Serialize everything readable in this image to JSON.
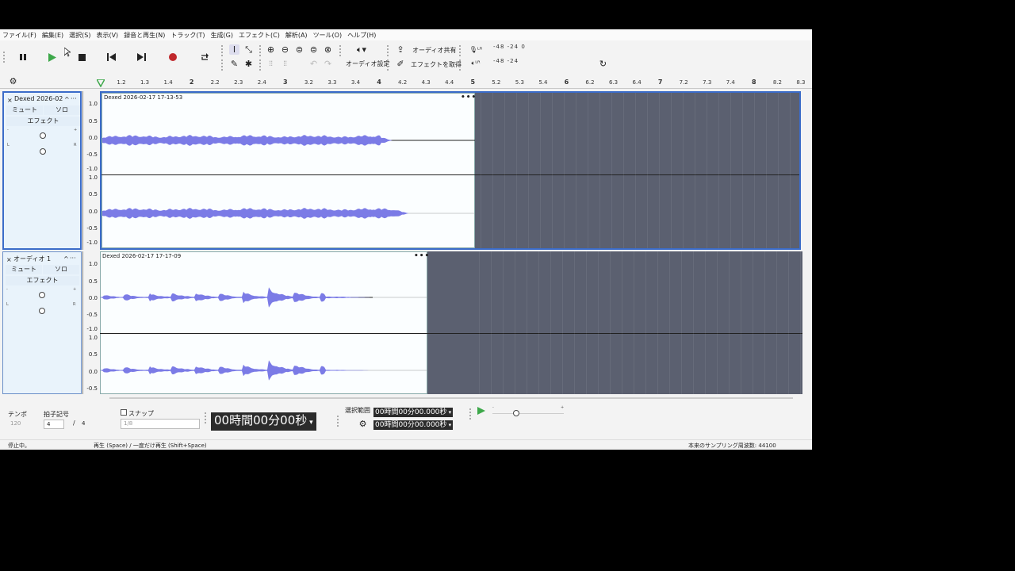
{
  "menu": [
    "ファイル(F)",
    "編集(E)",
    "選択(S)",
    "表示(V)",
    "録音と再生(N)",
    "トラック(T)",
    "生成(G)",
    "エフェクト(C)",
    "解析(A)",
    "ツール(O)",
    "ヘルプ(H)"
  ],
  "toolbar": {
    "audio_setup_label": "オーディオ設定",
    "share_audio_label": "オーディオ共有",
    "get_effects_label": "エフェクトを取得",
    "meter_scale_1": "-48   -24   0",
    "meter_scale_2": "-48   -24"
  },
  "ruler": {
    "ticks": [
      "1.2",
      "1.3",
      "1.4",
      "2",
      "2.2",
      "2.3",
      "2.4",
      "3",
      "3.2",
      "3.3",
      "3.4",
      "4",
      "4.2",
      "4.3",
      "4.4",
      "5",
      "5.2",
      "5.3",
      "5.4",
      "6",
      "6.2",
      "6.3",
      "6.4",
      "7",
      "7.2",
      "7.3",
      "7.4",
      "8",
      "8.2",
      "8.3"
    ],
    "major": [
      "2",
      "3",
      "4",
      "5",
      "6",
      "7",
      "8"
    ]
  },
  "tracks": [
    {
      "name": "Dexed 2026-02",
      "mute_label": "ミュート",
      "solo_label": "ソロ",
      "effects_label": "エフェクト",
      "clip_title": "Dexed 2026-02-17 17-13-53",
      "clip_menu": "•••",
      "gain_minus": "-",
      "gain_plus": "+",
      "pan_left": "L",
      "pan_right": "R",
      "labels_top": [
        "1.0",
        "0.5",
        "0.0",
        "-0.5",
        "-1.0"
      ],
      "labels_bottom": [
        "1.0",
        "0.5",
        "0.0",
        "-0.5",
        "-1.0"
      ]
    },
    {
      "name": "オーディオ 1",
      "mute_label": "ミュート",
      "solo_label": "ソロ",
      "effects_label": "エフェクト",
      "clip_title": "Dexed 2026-02-17 17-17-09",
      "clip_menu": "•••",
      "gain_minus": "-",
      "gain_plus": "+",
      "pan_left": "L",
      "pan_right": "R",
      "labels_top": [
        "1.0",
        "0.5",
        "0.0",
        "-0.5",
        "-1.0"
      ],
      "labels_bottom": [
        "1.0",
        "0.5",
        "0.0",
        "-0.5"
      ]
    }
  ],
  "bottom": {
    "tempo_label": "テンポ",
    "tempo_value": "120",
    "timesig_label": "拍子記号",
    "timesig_num": "4",
    "timesig_sep": "/",
    "timesig_den": "4",
    "snap_label": "スナップ",
    "snap_value": "1/8",
    "time_display": "00時間00分00秒",
    "selection_label": "選択範囲",
    "sel_start": "00時間00分00.000秒",
    "sel_end": "00時間00分00.000秒",
    "speed_minus": "-",
    "speed_plus": "+"
  },
  "status": {
    "state": "停止中。",
    "hint": "再生 (Space) / 一度だけ再生 (Shift+Space)",
    "rate": "本来のサンプリング周波数: 44100"
  },
  "colors": {
    "wave": "#7b7be6",
    "clip_bg": "#fbfeff",
    "empty_bg": "#5b6070",
    "play": "#3da84a",
    "record": "#c0282c"
  }
}
